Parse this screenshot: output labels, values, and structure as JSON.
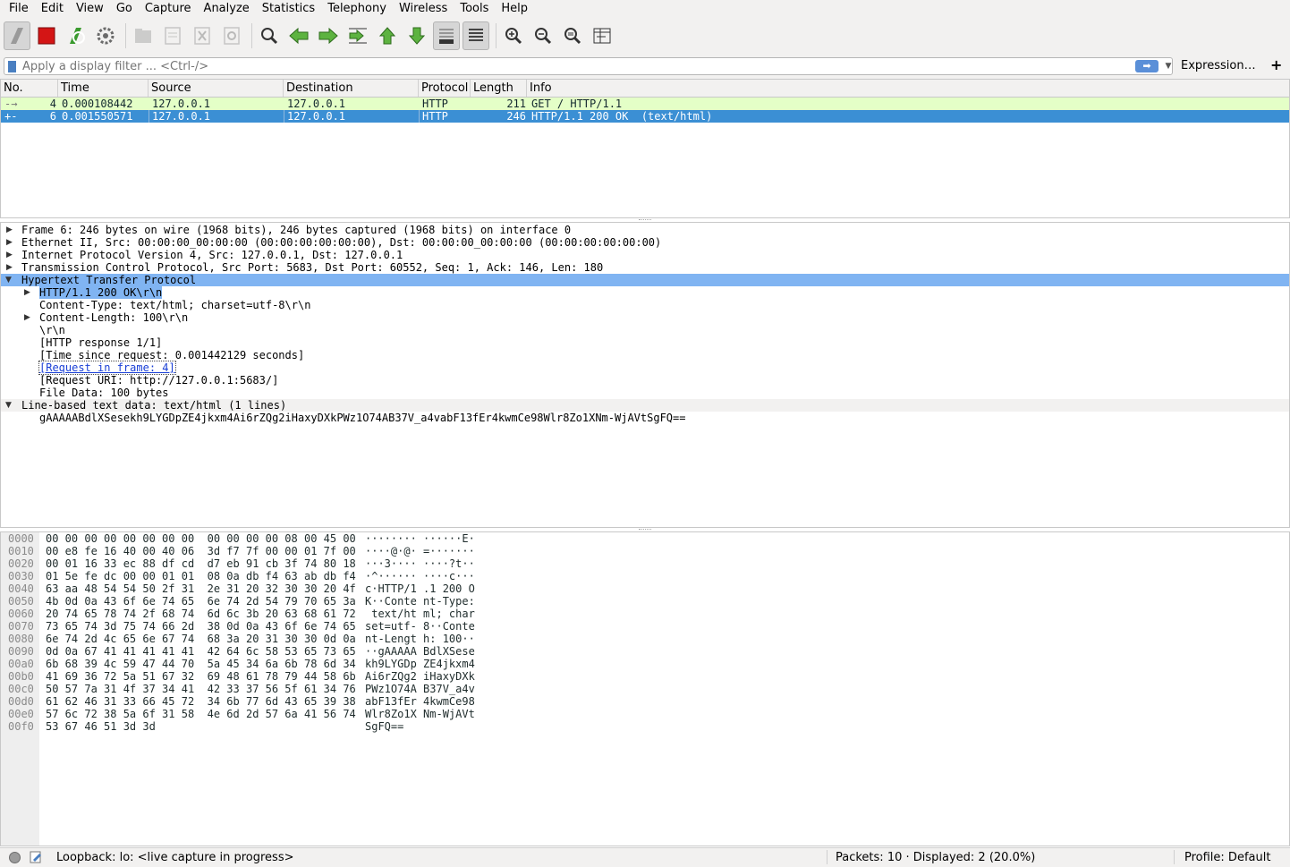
{
  "menubar": {
    "items": [
      {
        "label": "File"
      },
      {
        "label": "Edit"
      },
      {
        "label": "View"
      },
      {
        "label": "Go"
      },
      {
        "label": "Capture"
      },
      {
        "label": "Analyze"
      },
      {
        "label": "Statistics"
      },
      {
        "label": "Telephony"
      },
      {
        "label": "Wireless"
      },
      {
        "label": "Tools"
      },
      {
        "label": "Help"
      }
    ]
  },
  "toolbar": {
    "buttons": [
      "start-capture-icon",
      "stop-capture-icon",
      "restart-capture-icon",
      "capture-options-icon",
      "open-file-icon",
      "save-file-icon",
      "close-file-icon",
      "reload-file-icon",
      "find-packet-icon",
      "go-back-icon",
      "go-forward-icon",
      "go-to-packet-icon",
      "first-packet-icon",
      "last-packet-icon",
      "auto-scroll-icon",
      "colorize-icon",
      "zoom-in-icon",
      "zoom-out-icon",
      "normal-size-icon",
      "resize-columns-icon"
    ],
    "accent": "#3a9a2e"
  },
  "filter": {
    "placeholder": "Apply a display filter ... <Ctrl-/>",
    "value": "",
    "expression_label": "Expression…",
    "add_label": "+"
  },
  "packet_list": {
    "columns": [
      "No.",
      "Time",
      "Source",
      "Destination",
      "Protocol",
      "Length",
      "Info"
    ],
    "rows": [
      {
        "no": "4",
        "time": "0.000108442",
        "source": "127.0.0.1",
        "destination": "127.0.0.1",
        "protocol": "HTTP",
        "length": "211",
        "info": "GET / HTTP/1.1",
        "color": "#e4ffc7",
        "selected": false
      },
      {
        "no": "6",
        "time": "0.001550571",
        "source": "127.0.0.1",
        "destination": "127.0.0.1",
        "protocol": "HTTP",
        "length": "246",
        "info": "HTTP/1.1 200 OK  (text/html)",
        "color": "#3b8fd4",
        "selected": true
      }
    ]
  },
  "details": {
    "frame": "Frame 6: 246 bytes on wire (1968 bits), 246 bytes captured (1968 bits) on interface 0",
    "ethernet": "Ethernet II, Src: 00:00:00_00:00:00 (00:00:00:00:00:00), Dst: 00:00:00_00:00:00 (00:00:00:00:00:00)",
    "ip": "Internet Protocol Version 4, Src: 127.0.0.1, Dst: 127.0.0.1",
    "tcp": "Transmission Control Protocol, Src Port: 5683, Dst Port: 60552, Seq: 1, Ack: 146, Len: 180",
    "http": "Hypertext Transfer Protocol",
    "http_status": "HTTP/1.1 200 OK\\r\\n",
    "content_type": "Content-Type: text/html; charset=utf-8\\r\\n",
    "content_length": "Content-Length: 100\\r\\n",
    "crlf": "\\r\\n",
    "http_response": "[HTTP response 1/1]",
    "time_since": "[Time since request: 0.001442129 seconds]",
    "request_frame": "[Request in frame: 4]",
    "request_uri": "[Request URI: http://127.0.0.1:5683/]",
    "file_data": "File Data: 100 bytes",
    "line_based": "Line-based text data: text/html (1 lines)",
    "body_text": "gAAAAABdlXSesekh9LYGDpZE4jkxm4Ai6rZQg2iHaxyDXkPWz1O74AB37V_a4vabF13fEr4kwmCe98Wlr8Zo1XNm-WjAVtSgFQ=="
  },
  "bytes": {
    "rows": [
      {
        "offset": "0000",
        "hex": "00 00 00 00 00 00 00 00  00 00 00 00 08 00 45 00",
        "ascii": "········ ······E·"
      },
      {
        "offset": "0010",
        "hex": "00 e8 fe 16 40 00 40 06  3d f7 7f 00 00 01 7f 00",
        "ascii": "····@·@· =·······"
      },
      {
        "offset": "0020",
        "hex": "00 01 16 33 ec 88 df cd  d7 eb 91 cb 3f 74 80 18",
        "ascii": "···3···· ····?t··"
      },
      {
        "offset": "0030",
        "hex": "01 5e fe dc 00 00 01 01  08 0a db f4 63 ab db f4",
        "ascii": "·^······ ····c···"
      },
      {
        "offset": "0040",
        "hex": "63 aa 48 54 54 50 2f 31  2e 31 20 32 30 30 20 4f",
        "ascii": "c·HTTP/1 .1 200 O"
      },
      {
        "offset": "0050",
        "hex": "4b 0d 0a 43 6f 6e 74 65  6e 74 2d 54 79 70 65 3a",
        "ascii": "K··Conte nt-Type:"
      },
      {
        "offset": "0060",
        "hex": "20 74 65 78 74 2f 68 74  6d 6c 3b 20 63 68 61 72",
        "ascii": " text/ht ml; char"
      },
      {
        "offset": "0070",
        "hex": "73 65 74 3d 75 74 66 2d  38 0d 0a 43 6f 6e 74 65",
        "ascii": "set=utf- 8··Conte"
      },
      {
        "offset": "0080",
        "hex": "6e 74 2d 4c 65 6e 67 74  68 3a 20 31 30 30 0d 0a",
        "ascii": "nt-Lengt h: 100··"
      },
      {
        "offset": "0090",
        "hex": "0d 0a 67 41 41 41 41 41  42 64 6c 58 53 65 73 65",
        "ascii": "··gAAAAA BdlXSese"
      },
      {
        "offset": "00a0",
        "hex": "6b 68 39 4c 59 47 44 70  5a 45 34 6a 6b 78 6d 34",
        "ascii": "kh9LYGDp ZE4jkxm4"
      },
      {
        "offset": "00b0",
        "hex": "41 69 36 72 5a 51 67 32  69 48 61 78 79 44 58 6b",
        "ascii": "Ai6rZQg2 iHaxyDXk"
      },
      {
        "offset": "00c0",
        "hex": "50 57 7a 31 4f 37 34 41  42 33 37 56 5f 61 34 76",
        "ascii": "PWz1O74A B37V_a4v"
      },
      {
        "offset": "00d0",
        "hex": "61 62 46 31 33 66 45 72  34 6b 77 6d 43 65 39 38",
        "ascii": "abF13fEr 4kwmCe98"
      },
      {
        "offset": "00e0",
        "hex": "57 6c 72 38 5a 6f 31 58  4e 6d 2d 57 6a 41 56 74",
        "ascii": "Wlr8Zo1X Nm-WjAVt"
      },
      {
        "offset": "00f0",
        "hex": "53 67 46 51 3d 3d",
        "ascii": "SgFQ=="
      }
    ]
  },
  "statusbar": {
    "capture": "Loopback: lo: <live capture in progress>",
    "packets": "Packets: 10 · Displayed: 2 (20.0%)",
    "profile": "Profile: Default"
  }
}
